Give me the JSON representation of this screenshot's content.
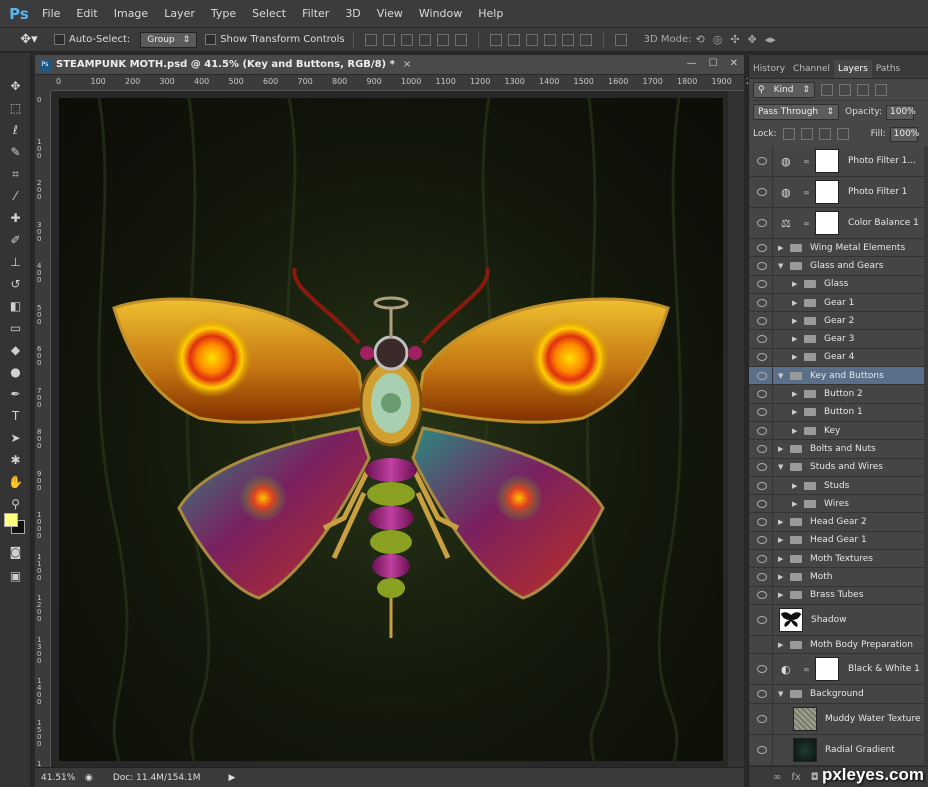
{
  "app": {
    "logo": "Ps",
    "menu": [
      "File",
      "Edit",
      "Image",
      "Layer",
      "Type",
      "Select",
      "Filter",
      "3D",
      "View",
      "Window",
      "Help"
    ]
  },
  "options": {
    "auto_select_label": "Auto-Select:",
    "auto_select_value": "Group",
    "show_transform_label": "Show Transform Controls",
    "mode_label": "3D Mode:"
  },
  "document": {
    "title": "STEAMPUNK MOTH.psd @ 41.5% (Key and Buttons, RGB/8) *",
    "ruler_h": [
      "0",
      "100",
      "200",
      "300",
      "400",
      "500",
      "600",
      "700",
      "800",
      "900",
      "1000",
      "1100",
      "1200",
      "1300",
      "1400",
      "1500",
      "1600",
      "1700",
      "1800",
      "1900",
      "2"
    ],
    "ruler_v": [
      "0",
      "100",
      "200",
      "300",
      "400",
      "500",
      "600",
      "700",
      "800",
      "900",
      "1000",
      "1100",
      "1200",
      "1300",
      "1400",
      "1500",
      "1600"
    ],
    "zoom": "41.51%",
    "doc_info": "Doc: 11.4M/154.1M"
  },
  "panel": {
    "tabs": [
      "History",
      "Channel",
      "Layers",
      "Paths"
    ],
    "active_tab": "Layers",
    "kind_label": "Kind",
    "blend_mode": "Pass Through",
    "opacity_label": "Opacity:",
    "opacity_value": "100%",
    "lock_label": "Lock:",
    "fill_label": "Fill:",
    "fill_value": "100%"
  },
  "layers": [
    {
      "name": "Photo Filter 1...",
      "type": "adjustment",
      "indent": 0,
      "icon": "photo-filter-icon"
    },
    {
      "name": "Photo Filter 1",
      "type": "adjustment",
      "indent": 0,
      "icon": "photo-filter-icon"
    },
    {
      "name": "Color Balance 1",
      "type": "adjustment",
      "indent": 0,
      "icon": "color-balance-icon"
    },
    {
      "name": "Wing Metal Elements",
      "type": "group",
      "indent": 0,
      "open": false
    },
    {
      "name": "Glass and Gears",
      "type": "group",
      "indent": 0,
      "open": true
    },
    {
      "name": "Glass",
      "type": "group",
      "indent": 1,
      "open": false
    },
    {
      "name": "Gear 1",
      "type": "group",
      "indent": 1,
      "open": false
    },
    {
      "name": "Gear 2",
      "type": "group",
      "indent": 1,
      "open": false
    },
    {
      "name": "Gear 3",
      "type": "group",
      "indent": 1,
      "open": false
    },
    {
      "name": "Gear 4",
      "type": "group",
      "indent": 1,
      "open": false
    },
    {
      "name": "Key and Buttons",
      "type": "group",
      "indent": 0,
      "open": true,
      "selected": true
    },
    {
      "name": "Button 2",
      "type": "group",
      "indent": 1,
      "open": false
    },
    {
      "name": "Button 1",
      "type": "group",
      "indent": 1,
      "open": false
    },
    {
      "name": "Key",
      "type": "group",
      "indent": 1,
      "open": false
    },
    {
      "name": "Bolts and Nuts",
      "type": "group",
      "indent": 0,
      "open": false
    },
    {
      "name": "Studs and Wires",
      "type": "group",
      "indent": 0,
      "open": true
    },
    {
      "name": "Studs",
      "type": "group",
      "indent": 1,
      "open": false
    },
    {
      "name": "Wires",
      "type": "group",
      "indent": 1,
      "open": false
    },
    {
      "name": "Head Gear 2",
      "type": "group",
      "indent": 0,
      "open": false
    },
    {
      "name": "Head Gear 1",
      "type": "group",
      "indent": 0,
      "open": false
    },
    {
      "name": "Moth Textures",
      "type": "group",
      "indent": 0,
      "open": false
    },
    {
      "name": "Moth",
      "type": "group",
      "indent": 0,
      "open": false
    },
    {
      "name": "Brass Tubes",
      "type": "group",
      "indent": 0,
      "open": false
    },
    {
      "name": "Shadow",
      "type": "pixel",
      "indent": 0,
      "thumb": "moth-silhouette"
    },
    {
      "name": "Moth Body Preparation",
      "type": "group",
      "indent": 0,
      "open": false,
      "hidden": true
    },
    {
      "name": "Black & White 1",
      "type": "adjustment",
      "indent": 0,
      "icon": "black-white-icon"
    },
    {
      "name": "Background",
      "type": "group",
      "indent": 0,
      "open": true
    },
    {
      "name": "Muddy Water Texture",
      "type": "pixel",
      "indent": 1,
      "thumb": "texture"
    },
    {
      "name": "Radial Gradient",
      "type": "pixel",
      "indent": 1,
      "thumb": "gradient"
    }
  ],
  "watermark": "pxleyes.com"
}
